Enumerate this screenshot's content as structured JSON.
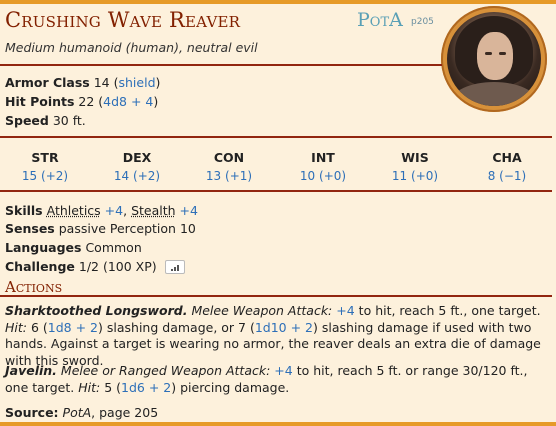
{
  "header": {
    "name": "Crushing Wave Reaver",
    "source_abbr": "PotA",
    "source_page": "p205",
    "subtitle": "Medium humanoid (human), neutral evil"
  },
  "stats": {
    "ac_label": "Armor Class",
    "ac_value": "14",
    "ac_note": "shield",
    "hp_label": "Hit Points",
    "hp_value": "22",
    "hp_roll": "4d8 + 4",
    "speed_label": "Speed",
    "speed_value": "30 ft."
  },
  "abilities": [
    {
      "name": "STR",
      "value": "15 (+2)"
    },
    {
      "name": "DEX",
      "value": "14 (+2)"
    },
    {
      "name": "CON",
      "value": "13 (+1)"
    },
    {
      "name": "INT",
      "value": "10 (+0)"
    },
    {
      "name": "WIS",
      "value": "11 (+0)"
    },
    {
      "name": "CHA",
      "value": "8 (−1)"
    }
  ],
  "traits": {
    "skills_label": "Skills",
    "skill1": "Athletics",
    "skill1_bonus": "+4",
    "skill2": "Stealth",
    "skill2_bonus": "+4",
    "senses_label": "Senses",
    "senses_value": "passive Perception 10",
    "languages_label": "Languages",
    "languages_value": "Common",
    "challenge_label": "Challenge",
    "challenge_value": "1/2 (100 XP)"
  },
  "actions": {
    "heading": "Actions",
    "a1_name": "Sharktoothed Longsword.",
    "a1_type": "Melee Weapon Attack:",
    "a1_bonus": "+4",
    "a1_text1": "to hit, reach 5 ft., one target.",
    "a1_hit": "Hit:",
    "a1_dmg1": "6",
    "a1_roll1": "1d8 + 2",
    "a1_text2": "slashing damage, or 7",
    "a1_roll2": "1d10 + 2",
    "a1_text3": "slashing damage if used with two hands. Against",
    "a1_text4": "a target is wearing no armor, the reaver deals an extra die of damage with this sword.",
    "a2_name": "Javelin.",
    "a2_type": "Melee or Ranged Weapon Attack:",
    "a2_bonus": "+4",
    "a2_text1": "to hit, reach 5 ft. or range 30/120 ft., one",
    "a2_text2": "target.",
    "a2_hit": "Hit:",
    "a2_dmg": "5",
    "a2_roll": "1d6 + 2",
    "a2_text3": "piercing damage."
  },
  "footer": {
    "source_label": "Source:",
    "source_book": "PotA",
    "source_page": ", page 205"
  },
  "colors": {
    "accent": "#822000",
    "link": "#2d6fb8",
    "bar": "#e69a28",
    "background": "#fdf1dc"
  }
}
